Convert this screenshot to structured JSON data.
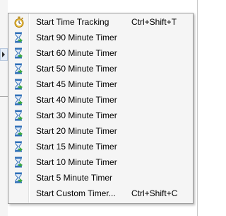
{
  "menu": {
    "items": [
      {
        "label": "Start Time Tracking",
        "shortcut": "Ctrl+Shift+T",
        "icon": "stopwatch-icon"
      },
      {
        "label": "Start 90 Minute Timer",
        "shortcut": "",
        "icon": "hourglass-icon"
      },
      {
        "label": "Start 60 Minute Timer",
        "shortcut": "",
        "icon": "hourglass-icon"
      },
      {
        "label": "Start 50 Minute Timer",
        "shortcut": "",
        "icon": "hourglass-icon"
      },
      {
        "label": "Start 45 Minute Timer",
        "shortcut": "",
        "icon": "hourglass-icon"
      },
      {
        "label": "Start 40 Minute Timer",
        "shortcut": "",
        "icon": "hourglass-icon"
      },
      {
        "label": "Start 30 Minute Timer",
        "shortcut": "",
        "icon": "hourglass-icon"
      },
      {
        "label": "Start 20 Minute Timer",
        "shortcut": "",
        "icon": "hourglass-icon"
      },
      {
        "label": "Start 15 Minute Timer",
        "shortcut": "",
        "icon": "hourglass-icon"
      },
      {
        "label": "Start 10 Minute Timer",
        "shortcut": "",
        "icon": "hourglass-icon"
      },
      {
        "label": "Start 5 Minute Timer",
        "shortcut": "",
        "icon": "hourglass-icon"
      },
      {
        "label": "Start Custom Timer...",
        "shortcut": "Ctrl+Shift+C",
        "icon": ""
      }
    ]
  },
  "colors": {
    "menu_background": "#f5f5f5",
    "menu_border": "#979797",
    "hourglass_blue": "#2f6fb8",
    "arrow_green": "#3aa843",
    "stopwatch_gold": "#d9a520"
  }
}
